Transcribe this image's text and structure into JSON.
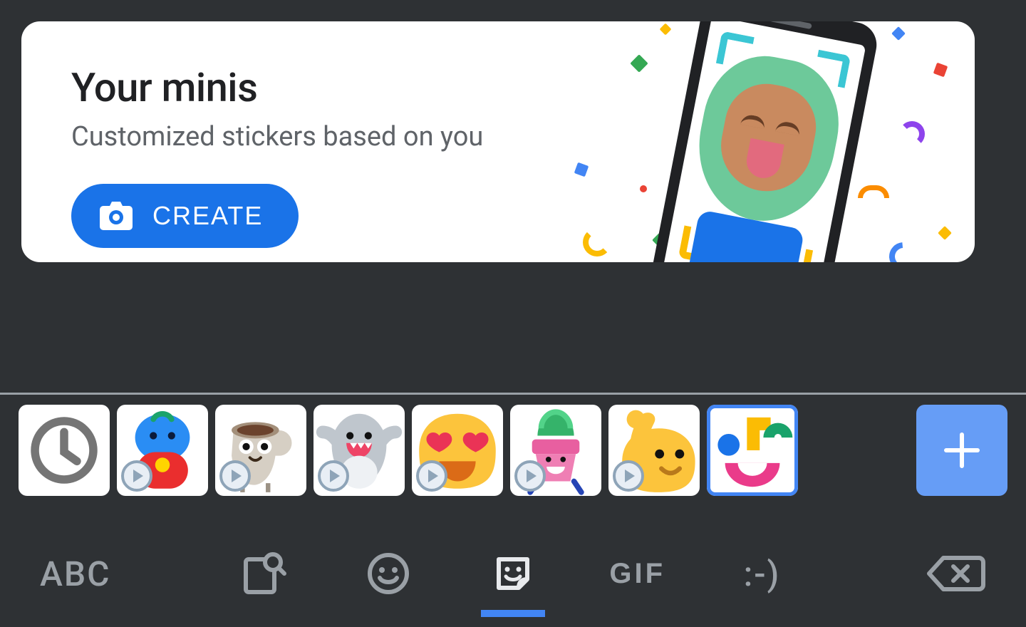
{
  "promo": {
    "title": "Your minis",
    "subtitle": "Customized stickers based on you",
    "create_label": "CREATE"
  },
  "colors": {
    "accent": "#1a73e8",
    "accent_light": "#669df6",
    "icon_inactive": "#9aa0a6",
    "icon_active": "#e8eaed"
  },
  "packs": [
    {
      "id": "recent",
      "kind": "recent",
      "playable": false,
      "desc": "Recent stickers"
    },
    {
      "id": "blue-bird",
      "kind": "sticker",
      "playable": true,
      "desc": "Blue bird in red pants"
    },
    {
      "id": "coffee",
      "kind": "sticker",
      "playable": true,
      "desc": "Coffee cup with face"
    },
    {
      "id": "shark",
      "kind": "sticker",
      "playable": true,
      "desc": "Happy shark"
    },
    {
      "id": "love-blob",
      "kind": "sticker",
      "playable": true,
      "desc": "Heart-eyes blob emoji"
    },
    {
      "id": "plant",
      "kind": "sticker",
      "playable": true,
      "desc": "Smiling potted plant"
    },
    {
      "id": "flex-blob",
      "kind": "sticker",
      "playable": true,
      "desc": "Flexing arm blob"
    },
    {
      "id": "minis",
      "kind": "sticker",
      "playable": false,
      "desc": "Your minis pack",
      "active": true
    }
  ],
  "add_label": "+",
  "categories": {
    "abc_label": "ABC",
    "gif_label": "GIF",
    "text_emoticon": ":-)",
    "active": "sticker"
  }
}
